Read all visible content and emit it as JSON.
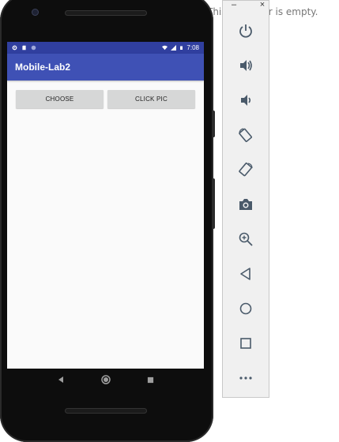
{
  "background_text": "This emulator is empty.",
  "window_controls": {
    "minimize": "–",
    "close": "×"
  },
  "device": {
    "status_bar": {
      "time": "7:08"
    },
    "app_bar": {
      "title": "Mobile-Lab2"
    },
    "buttons": {
      "choose": "CHOOSE",
      "click_pic": "CLICK PIC"
    }
  },
  "colors": {
    "status_bar": "#303f9f",
    "app_bar": "#3f51b5",
    "button_bg": "#d6d7d7",
    "panel_icon": "#4a5a6a"
  },
  "emulator_tools": [
    "power-icon",
    "volume-up-icon",
    "volume-down-icon",
    "rotate-left-icon",
    "rotate-right-icon",
    "camera-icon",
    "zoom-icon",
    "back-icon",
    "home-icon",
    "overview-icon",
    "more-icon"
  ]
}
